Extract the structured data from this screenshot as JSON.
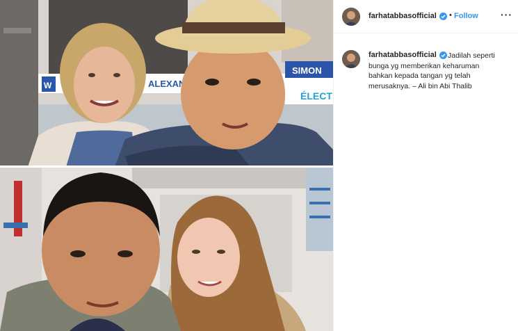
{
  "post": {
    "username": "farhatabbasofficial",
    "verified": true,
    "separator": "•",
    "follow_label": "Follow",
    "more_icon": "more-horizontal-icon",
    "caption": "Jadilah seperti\nbunga yg memberikan keharuman\nbahkan kepada tangan yg telah\nmerusaknya. – Ali bin Abi Thalib"
  },
  "photo": {
    "banner_texts": [
      "W",
      "ALEXAN",
      "SIMON",
      "ÉLECT"
    ]
  },
  "colors": {
    "accent": "#3897f0",
    "text": "#262626",
    "border": "#efefef"
  }
}
